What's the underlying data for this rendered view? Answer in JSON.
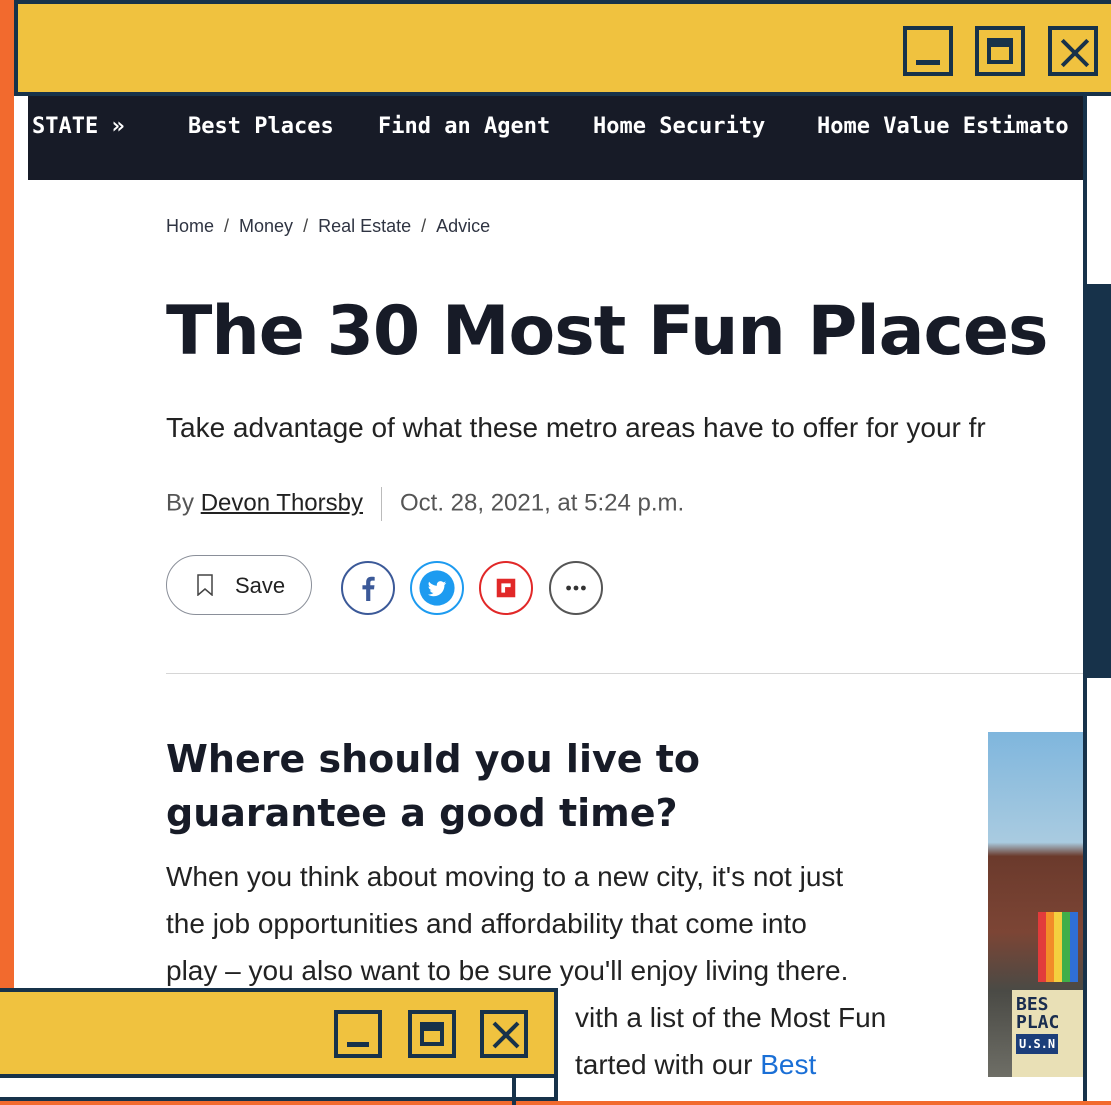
{
  "window": {
    "controls": {
      "minimize": "minimize-icon",
      "maximize": "maximize-icon",
      "close": "close-icon"
    },
    "colors": {
      "frame": "#f0c23f",
      "border": "#17324a",
      "desktop": "#f26a2e"
    }
  },
  "nav": {
    "items": [
      "STATE »",
      "Best Places",
      "Find an Agent",
      "Home Security",
      "Home Value Estimato"
    ]
  },
  "breadcrumb": [
    "Home",
    "Money",
    "Real Estate",
    "Advice"
  ],
  "article": {
    "title": "The 30 Most Fun Places",
    "dek": "Take advantage of what these metro areas have to offer for your fr",
    "byline_prefix": "By",
    "author": "Devon Thorsby",
    "date": "Oct. 28, 2021, at 5:24 p.m.",
    "save_label": "Save",
    "share_icons": [
      "facebook-icon",
      "twitter-icon",
      "flipboard-icon",
      "more-icon"
    ],
    "section_heading": "Where should you live to guarantee a good time?",
    "body_line1": "When you think about moving to a new city, it's not just",
    "body_line2": "the job opportunities and affordability that come into",
    "body_line3": "play – you also want to be sure you'll enjoy living there.",
    "body_line4": "vith a list of the Most Fun",
    "body_line5_text": "tarted with our ",
    "body_line5_link": "Best",
    "thumb_sign_line1": "BES",
    "thumb_sign_line2": "PLAC",
    "thumb_badge": "U.S.N"
  }
}
